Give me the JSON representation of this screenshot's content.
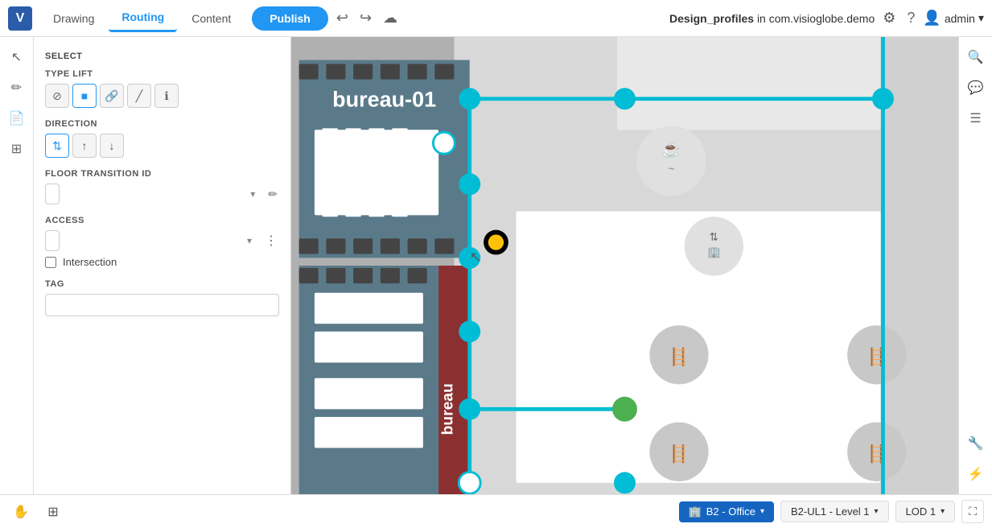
{
  "topbar": {
    "logo": "V",
    "tabs": [
      {
        "id": "drawing",
        "label": "Drawing",
        "active": false
      },
      {
        "id": "routing",
        "label": "Routing",
        "active": true
      },
      {
        "id": "content",
        "label": "Content",
        "active": false
      }
    ],
    "publish_label": "Publish",
    "undo_icon": "↩",
    "redo_icon": "↪",
    "cloud_icon": "☁",
    "project_title": "Design_profiles",
    "project_in": "in",
    "project_domain": "com.visioglobe.demo",
    "gear_icon": "⚙",
    "help_icon": "?",
    "user_icon": "👤",
    "username": "admin"
  },
  "left_icon_sidebar": {
    "icons": [
      {
        "id": "cursor",
        "symbol": "↖",
        "active": false
      },
      {
        "id": "pencil",
        "symbol": "✏",
        "active": false
      },
      {
        "id": "doc",
        "symbol": "📄",
        "active": false
      },
      {
        "id": "layers",
        "symbol": "⊞",
        "active": false
      }
    ]
  },
  "left_panel": {
    "select_label": "SELECT",
    "type_lift_label": "TYPE LIFT",
    "type_buttons": [
      {
        "id": "ban",
        "symbol": "⊘",
        "active": false
      },
      {
        "id": "square",
        "symbol": "■",
        "active": true
      },
      {
        "id": "link",
        "symbol": "🔗",
        "active": false
      },
      {
        "id": "diagonal",
        "symbol": "╱",
        "active": false
      },
      {
        "id": "info",
        "symbol": "ℹ",
        "active": false
      }
    ],
    "direction_label": "DIRECTION",
    "direction_buttons": [
      {
        "id": "both",
        "symbol": "⇅",
        "active": true
      },
      {
        "id": "up",
        "symbol": "↑",
        "active": false
      },
      {
        "id": "down",
        "symbol": "↓",
        "active": false
      }
    ],
    "floor_transition_label": "FLOOR TRANSITION ID",
    "floor_transition_placeholder": "",
    "floor_transition_options": [],
    "edit_icon": "✏",
    "access_label": "ACCESS",
    "access_placeholder": "",
    "access_options": [],
    "more_icon": "⋮",
    "intersection_label": "Intersection",
    "tag_label": "TAG",
    "tag_value": ""
  },
  "map": {
    "background_color": "#c8c8c8",
    "floor_label": "B2 - Office",
    "level_label": "B2-UL1 - Level 1",
    "lod_label": "LOD 1"
  },
  "right_sidebar": {
    "icons": [
      {
        "id": "search",
        "symbol": "🔍"
      },
      {
        "id": "chat",
        "symbol": "💬"
      },
      {
        "id": "list",
        "symbol": "☰"
      },
      {
        "id": "tools",
        "symbol": "🔧"
      },
      {
        "id": "lightning",
        "symbol": "⚡"
      }
    ]
  },
  "bottom_bar": {
    "hand_tool_icon": "✋",
    "floor_plan_icon": "⊞",
    "floor_btn_label": "B2 - Office",
    "level_btn_label": "B2-UL1 - Level 1",
    "lod_btn_label": "LOD 1",
    "fullscreen_icon": "⛶"
  }
}
